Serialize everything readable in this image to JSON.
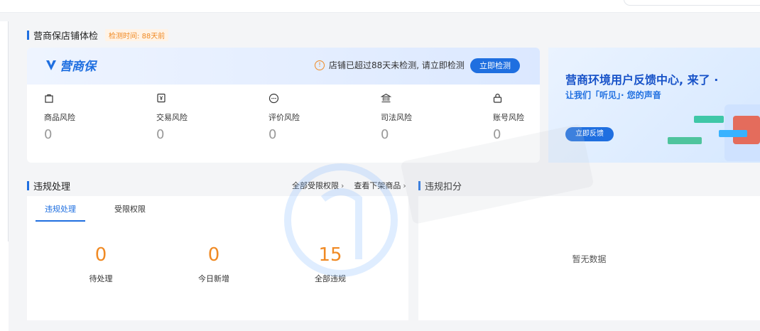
{
  "health_check": {
    "title": "营商保店铺体检",
    "check_tag": "检测时间: 88天前",
    "logo_text": "营商保",
    "warning_text": "店铺已超过88天未检测, 请立即检测",
    "check_button": "立即检测",
    "risks": [
      {
        "icon": "bag-icon",
        "label": "商品风险",
        "value": "0"
      },
      {
        "icon": "yuan-doc-icon",
        "label": "交易风险",
        "value": "0"
      },
      {
        "icon": "comment-icon",
        "label": "评价风险",
        "value": "0"
      },
      {
        "icon": "court-icon",
        "label": "司法风险",
        "value": "0"
      },
      {
        "icon": "lock-icon",
        "label": "账号风险",
        "value": "0"
      }
    ]
  },
  "banner": {
    "title": "营商环境用户反馈中心, 来了 ·",
    "subtitle": "让我们「听见」· 您的声音",
    "button": "立即反馈"
  },
  "violations": {
    "title": "违规处理",
    "link_restricted": "全部受限权限",
    "link_removed": "查看下架商品",
    "tabs": [
      "违规处理",
      "受限权限"
    ],
    "active_tab": "违规处理",
    "stats": [
      {
        "value": "0",
        "label": "待处理"
      },
      {
        "value": "0",
        "label": "今日新增"
      },
      {
        "value": "15",
        "label": "全部违规"
      }
    ]
  },
  "deduction": {
    "title": "违规扣分",
    "empty_text": "暂无数据"
  },
  "colors": {
    "accent": "#1f6fe0",
    "warning": "#f08a24"
  }
}
